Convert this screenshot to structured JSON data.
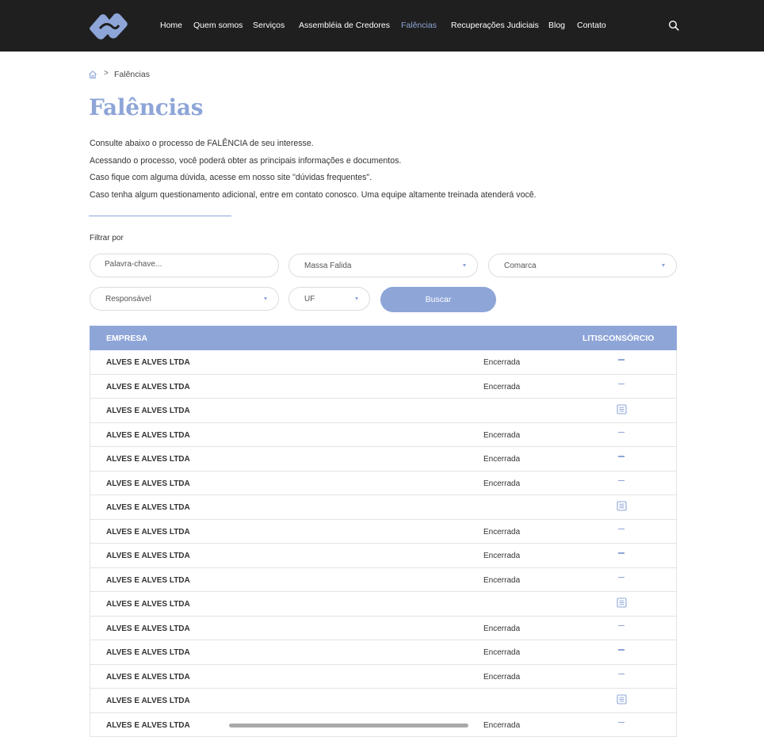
{
  "nav": {
    "items": [
      {
        "label": "Home",
        "active": false
      },
      {
        "label": "Quem somos",
        "active": false
      },
      {
        "label": "Serviços",
        "active": false
      },
      {
        "label": "Assembléia de Credores",
        "active": false
      },
      {
        "label": "Falências",
        "active": true
      },
      {
        "label": "Recuperações Judiciais",
        "active": false
      },
      {
        "label": "Blog",
        "active": false
      },
      {
        "label": "Contato",
        "active": false
      }
    ],
    "search_icon": "search-icon"
  },
  "breadcrumb": {
    "home_icon": "home-icon",
    "separator": ">",
    "current": "Falências"
  },
  "page": {
    "title": "Falências",
    "intro": [
      "Consulte abaixo o processo de FALÊNCIA de seu interesse.",
      "Acessando o processo, você poderá obter as principais informações e documentos.",
      "Caso fique com alguma dúvida, acesse em nosso site \"dúvidas frequentes\".",
      "Caso tenha algum questionamento adicional, entre em contato conosco. Uma equipe altamente treinada atenderá você."
    ]
  },
  "filters": {
    "label": "Filtrar por",
    "keyword_placeholder": "Palavra-chave...",
    "massa_falida": "Massa Falida",
    "comarca": "Comarca",
    "responsavel": "Responsável",
    "uf": "UF",
    "search_button": "Buscar"
  },
  "table": {
    "headers": {
      "empresa": "EMPRESA",
      "litisconsorcio": "LITISCONSÓRCIO"
    },
    "rows": [
      {
        "empresa": "ALVES E ALVES LTDA",
        "status": "Encerrada",
        "litisconsorcio": "dash"
      },
      {
        "empresa": "ALVES E ALVES LTDA",
        "status": "Encerrada",
        "litisconsorcio": "dash"
      },
      {
        "empresa": "ALVES E ALVES LTDA",
        "status": "",
        "litisconsorcio": "document"
      },
      {
        "empresa": "ALVES E ALVES LTDA",
        "status": "Encerrada",
        "litisconsorcio": "dash"
      },
      {
        "empresa": "ALVES E ALVES LTDA",
        "status": "Encerrada",
        "litisconsorcio": "dash"
      },
      {
        "empresa": "ALVES E ALVES LTDA",
        "status": "Encerrada",
        "litisconsorcio": "dash"
      },
      {
        "empresa": "ALVES E ALVES LTDA",
        "status": "",
        "litisconsorcio": "document"
      },
      {
        "empresa": "ALVES E ALVES LTDA",
        "status": "Encerrada",
        "litisconsorcio": "dash"
      },
      {
        "empresa": "ALVES E ALVES LTDA",
        "status": "Encerrada",
        "litisconsorcio": "dash"
      },
      {
        "empresa": "ALVES E ALVES LTDA",
        "status": "Encerrada",
        "litisconsorcio": "dash"
      },
      {
        "empresa": "ALVES E ALVES LTDA",
        "status": "",
        "litisconsorcio": "document"
      },
      {
        "empresa": "ALVES E ALVES LTDA",
        "status": "Encerrada",
        "litisconsorcio": "dash"
      },
      {
        "empresa": "ALVES E ALVES LTDA",
        "status": "Encerrada",
        "litisconsorcio": "dash"
      },
      {
        "empresa": "ALVES E ALVES LTDA",
        "status": "Encerrada",
        "litisconsorcio": "dash"
      },
      {
        "empresa": "ALVES E ALVES LTDA",
        "status": "",
        "litisconsorcio": "document"
      },
      {
        "empresa": "ALVES E ALVES LTDA",
        "status": "Encerrada",
        "litisconsorcio": "dash"
      }
    ]
  },
  "colors": {
    "accent": "#8ea5d8",
    "header_bg": "#1f1f1f"
  }
}
